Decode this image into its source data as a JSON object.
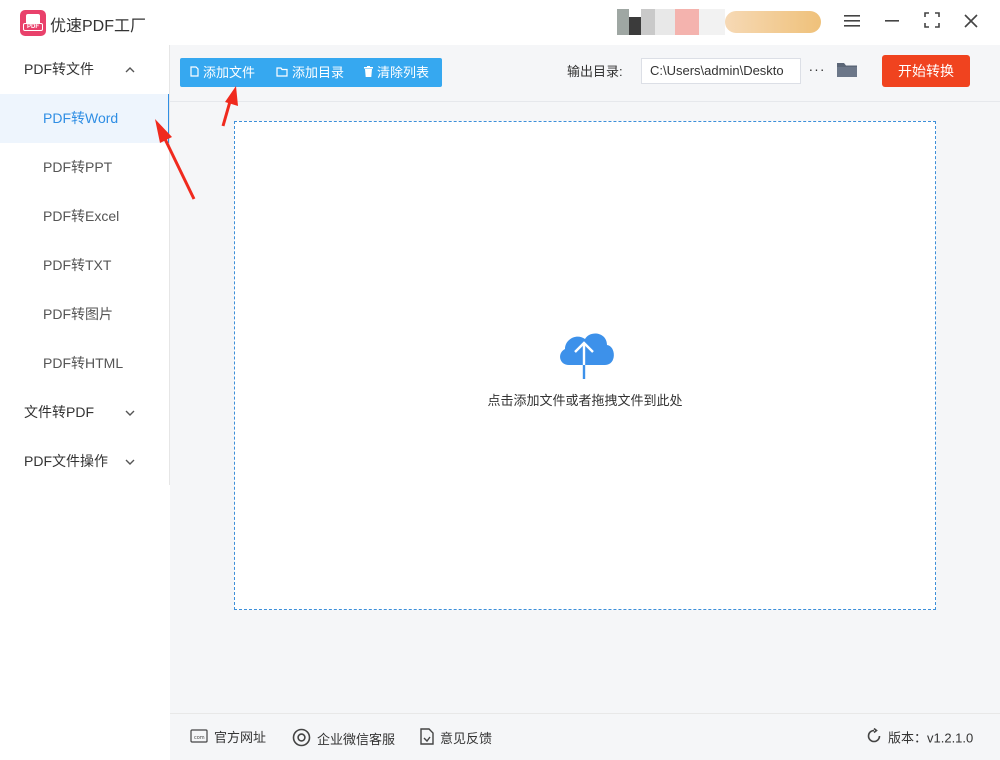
{
  "app": {
    "title": "优速PDF工厂",
    "logo_text": "PDF"
  },
  "window": {
    "menu_icon": "hamburger-icon",
    "min_icon": "minimize-icon",
    "max_icon": "maximize-icon",
    "close_icon": "close-icon"
  },
  "sidebar": {
    "groups": [
      {
        "label": "PDF转文件",
        "expanded": true,
        "items": [
          {
            "label": "PDF转Word",
            "active": true
          },
          {
            "label": "PDF转PPT"
          },
          {
            "label": "PDF转Excel"
          },
          {
            "label": "PDF转TXT"
          },
          {
            "label": "PDF转图片"
          },
          {
            "label": "PDF转HTML"
          }
        ]
      },
      {
        "label": "文件转PDF",
        "expanded": false
      },
      {
        "label": "PDF文件操作",
        "expanded": false
      }
    ]
  },
  "toolbar": {
    "add_file": "添加文件",
    "add_folder": "添加目录",
    "clear_list": "清除列表",
    "output_label": "输出目录:",
    "output_path": "C:\\Users\\admin\\Deskto",
    "more": "···",
    "start": "开始转换"
  },
  "dropzone": {
    "hint": "点击添加文件或者拖拽文件到此处"
  },
  "footer": {
    "website": "官方网址",
    "wechat": "企业微信客服",
    "feedback": "意见反馈",
    "version": "版本：v1.2.1.0"
  },
  "colors": {
    "accent": "#36a8f0",
    "start": "#f0431f",
    "active_text": "#2f8ee4",
    "logo": "#e9416b"
  }
}
